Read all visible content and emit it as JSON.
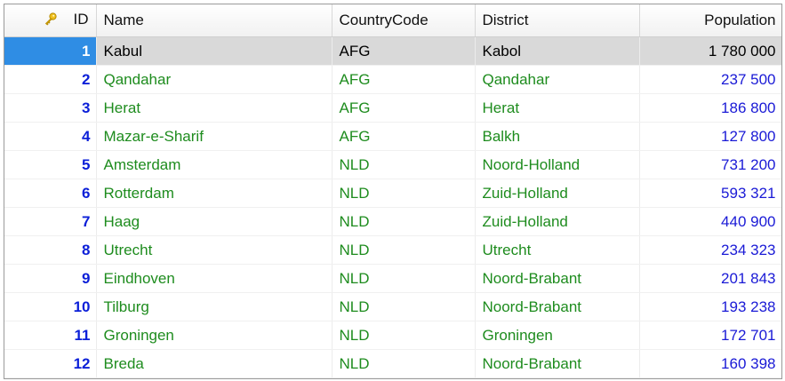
{
  "columns": {
    "id": "ID",
    "name": "Name",
    "country_code": "CountryCode",
    "district": "District",
    "population": "Population"
  },
  "icons": {
    "primary_key": "key-icon"
  },
  "colors": {
    "id_text": "#0b1fd8",
    "text_green": "#1e8c1e",
    "population_text": "#1a1ad6",
    "selected_row_bg": "#d9d9d9",
    "selected_id_bg": "#2f8de4"
  },
  "selected_row_index": 0,
  "rows": [
    {
      "id": "1",
      "name": "Kabul",
      "country_code": "AFG",
      "district": "Kabol",
      "population": "1 780 000"
    },
    {
      "id": "2",
      "name": "Qandahar",
      "country_code": "AFG",
      "district": "Qandahar",
      "population": "237 500"
    },
    {
      "id": "3",
      "name": "Herat",
      "country_code": "AFG",
      "district": "Herat",
      "population": "186 800"
    },
    {
      "id": "4",
      "name": "Mazar-e-Sharif",
      "country_code": "AFG",
      "district": "Balkh",
      "population": "127 800"
    },
    {
      "id": "5",
      "name": "Amsterdam",
      "country_code": "NLD",
      "district": "Noord-Holland",
      "population": "731 200"
    },
    {
      "id": "6",
      "name": "Rotterdam",
      "country_code": "NLD",
      "district": "Zuid-Holland",
      "population": "593 321"
    },
    {
      "id": "7",
      "name": "Haag",
      "country_code": "NLD",
      "district": "Zuid-Holland",
      "population": "440 900"
    },
    {
      "id": "8",
      "name": "Utrecht",
      "country_code": "NLD",
      "district": "Utrecht",
      "population": "234 323"
    },
    {
      "id": "9",
      "name": "Eindhoven",
      "country_code": "NLD",
      "district": "Noord-Brabant",
      "population": "201 843"
    },
    {
      "id": "10",
      "name": "Tilburg",
      "country_code": "NLD",
      "district": "Noord-Brabant",
      "population": "193 238"
    },
    {
      "id": "11",
      "name": "Groningen",
      "country_code": "NLD",
      "district": "Groningen",
      "population": "172 701"
    },
    {
      "id": "12",
      "name": "Breda",
      "country_code": "NLD",
      "district": "Noord-Brabant",
      "population": "160 398"
    }
  ]
}
